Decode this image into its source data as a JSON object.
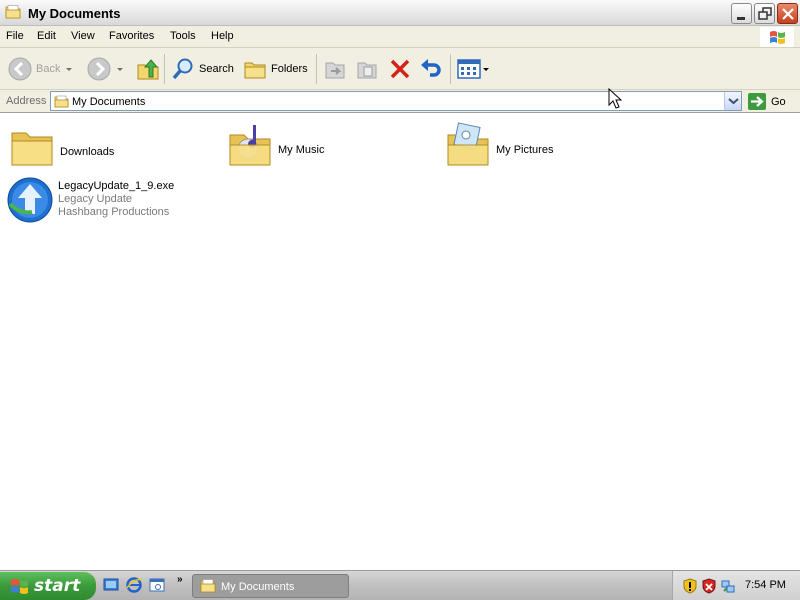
{
  "window": {
    "title": "My Documents"
  },
  "menu": {
    "items": [
      "File",
      "Edit",
      "View",
      "Favorites",
      "Tools",
      "Help"
    ]
  },
  "toolbar": {
    "back_label": "Back",
    "search_label": "Search",
    "folders_label": "Folders"
  },
  "address": {
    "label": "Address",
    "value": "My Documents",
    "go_label": "Go"
  },
  "content": {
    "items": [
      {
        "name": "Downloads",
        "icon": "folder-icon"
      },
      {
        "name": "My Music",
        "icon": "music-folder-icon"
      },
      {
        "name": "My Pictures",
        "icon": "pictures-folder-icon"
      },
      {
        "name": "LegacyUpdate_1_9.exe",
        "line2": "Legacy Update",
        "line3": "Hashbang Productions",
        "icon": "legacy-update-icon"
      }
    ]
  },
  "taskbar": {
    "start_label": "start",
    "task_label": "My Documents",
    "clock": "7:54 PM"
  },
  "colors": {
    "start_green": "#3a9a3a",
    "close_red": "#c5401e",
    "folder_yellow": "#f5d66a",
    "accent_blue": "#1f64c8"
  }
}
